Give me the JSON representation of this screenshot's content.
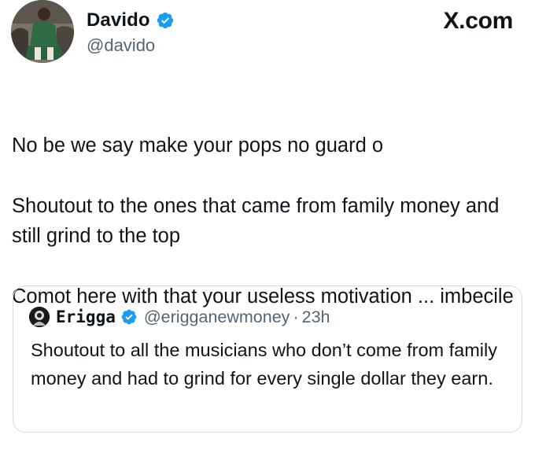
{
  "author": {
    "display_name": "Davido",
    "handle": "@davido",
    "verified": true
  },
  "brand": {
    "label": "X.com"
  },
  "tweet": {
    "lines": [
      "No be we say make your pops no guard o",
      "Shoutout to the ones that came from family money and still grind to the top",
      "Comot here with that your useless motivation ... imbecile"
    ]
  },
  "quoted_tweet": {
    "display_name": "Erigga",
    "handle": "@erigganewmoney",
    "separator": "·",
    "time": "23h",
    "verified": true,
    "text": "Shoutout to all the musicians who don’t come from family money and had to grind for every single dollar they earn."
  },
  "colors": {
    "text": "#0f1419",
    "secondary": "#536471",
    "verified_blue": "#1d9bf0",
    "border": "#d6dce0"
  }
}
